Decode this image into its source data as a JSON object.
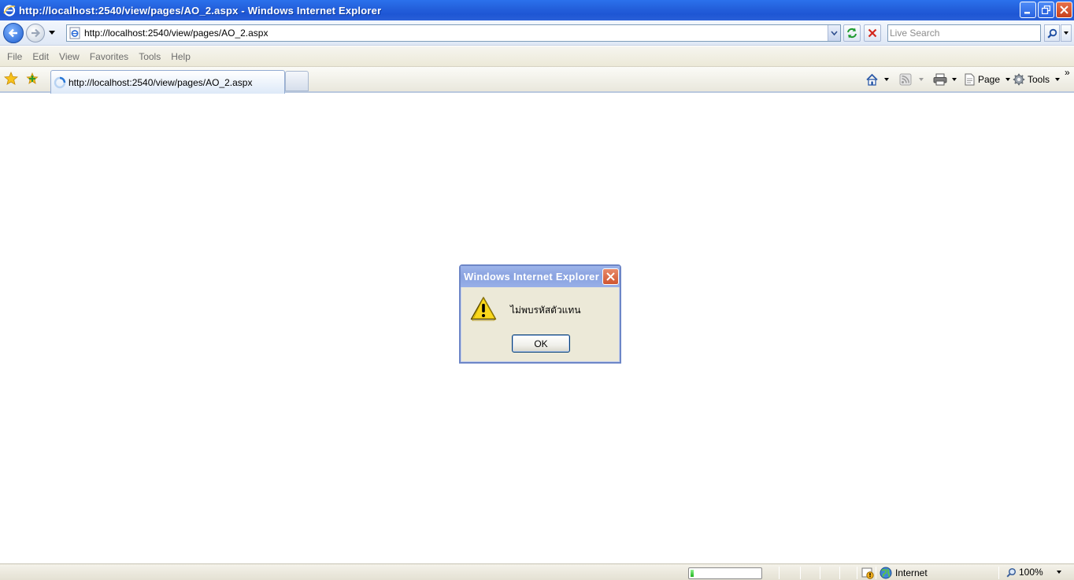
{
  "window": {
    "title": "http://localhost:2540/view/pages/AO_2.aspx - Windows Internet Explorer"
  },
  "address_bar": {
    "url": "http://localhost:2540/view/pages/AO_2.aspx"
  },
  "search": {
    "placeholder": "Live Search"
  },
  "menu": {
    "items": [
      "File",
      "Edit",
      "View",
      "Favorites",
      "Tools",
      "Help"
    ]
  },
  "tab": {
    "label": "http://localhost:2540/view/pages/AO_2.aspx"
  },
  "commands": {
    "page_label": "Page",
    "tools_label": "Tools"
  },
  "dialog": {
    "title": "Windows Internet Explorer",
    "message": "ไม่พบรหัสตัวแทน",
    "ok_label": "OK",
    "icon": "warning-icon"
  },
  "status": {
    "zone_label": "Internet",
    "zoom_label": "100%",
    "progress_fraction": 0.05
  },
  "colors": {
    "titlebar": "#2461dc",
    "dialog_title": "#8aa3e0",
    "chrome": "#ece9d8"
  }
}
